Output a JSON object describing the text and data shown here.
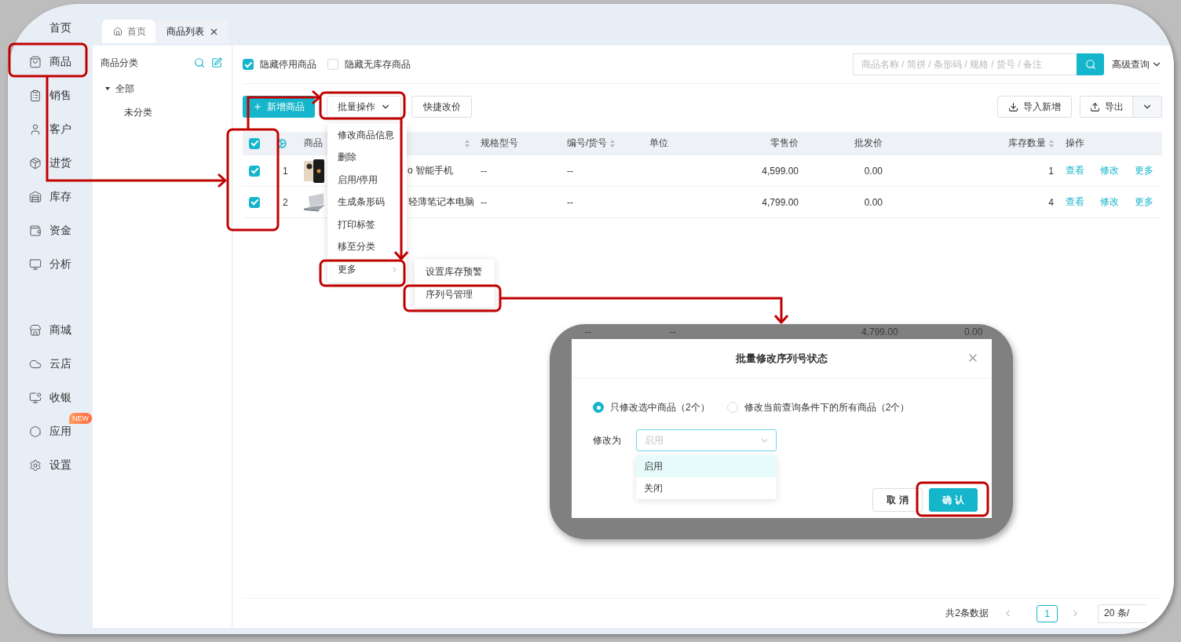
{
  "sidebar": {
    "groups": [
      {
        "items": [
          {
            "label": "首页"
          },
          {
            "label": "商品"
          },
          {
            "label": "销售"
          },
          {
            "label": "客户"
          },
          {
            "label": "进货"
          },
          {
            "label": "库存"
          },
          {
            "label": "资金"
          },
          {
            "label": "分析"
          }
        ]
      },
      {
        "items": [
          {
            "label": "商城"
          },
          {
            "label": "云店"
          },
          {
            "label": "收银"
          },
          {
            "label": "应用",
            "badge": "NEW"
          },
          {
            "label": "设置"
          }
        ]
      }
    ]
  },
  "tabs": [
    {
      "label": "首页",
      "selected": false,
      "closable": false
    },
    {
      "label": "商品列表",
      "selected": true,
      "closable": true
    }
  ],
  "category": {
    "title": "商品分类",
    "tree": [
      {
        "label": "全部",
        "expanded": true,
        "children": [
          {
            "label": "未分类"
          }
        ]
      }
    ]
  },
  "filters": [
    {
      "label": "隐藏停用商品",
      "checked": true
    },
    {
      "label": "隐藏无库存商品",
      "checked": false
    }
  ],
  "search": {
    "placeholder": "商品名称 / 简拼 / 条形码 / 规格 / 货号 / 备注",
    "advanced": "高级查询"
  },
  "toolbar": {
    "left": [
      {
        "label": "新增商品",
        "kind": "primary"
      },
      {
        "label": "批量操作",
        "kind": "dropdown"
      },
      {
        "label": "快捷改价",
        "kind": "plain"
      }
    ],
    "right": [
      {
        "label": "导入新增",
        "kind": "import"
      },
      {
        "label": "导出",
        "kind": "export"
      }
    ]
  },
  "table": {
    "header_checked": true,
    "columns": [
      {
        "label": "商品",
        "sortable": true
      },
      {
        "label": "规格型号",
        "sortable": false
      },
      {
        "label": "编号/货号",
        "sortable": true
      },
      {
        "label": "单位",
        "sortable": false
      },
      {
        "label": "零售价",
        "sortable": false
      },
      {
        "label": "批发价",
        "sortable": false
      },
      {
        "label": "库存数量",
        "sortable": true
      },
      {
        "label": "操作",
        "sortable": false
      }
    ],
    "rows": [
      {
        "checked": true,
        "index": "1",
        "name": "o 智能手机",
        "spec": "--",
        "code": "--",
        "retail": "4,599.00",
        "wholesale": "0.00",
        "stock": "1",
        "actions": [
          "查看",
          "修改",
          "更多"
        ]
      },
      {
        "checked": true,
        "index": "2",
        "name": "轻薄笔记本电脑",
        "spec": "--",
        "code": "--",
        "retail": "4,799.00",
        "wholesale": "0.00",
        "stock": "4",
        "actions": [
          "查看",
          "修改",
          "更多"
        ]
      }
    ]
  },
  "batch_menu": {
    "items": [
      {
        "label": "修改商品信息",
        "kind": "item"
      },
      {
        "label": "删除",
        "kind": "item"
      },
      {
        "label": "启用/停用",
        "kind": "item"
      },
      {
        "label": "生成条形码",
        "kind": "item"
      },
      {
        "label": "打印标签",
        "kind": "item"
      },
      {
        "label": "移至分类",
        "kind": "item"
      },
      {
        "label": "更多",
        "kind": "submenu"
      }
    ]
  },
  "submenu": {
    "items": [
      "设置库存预警",
      "序列号管理"
    ]
  },
  "pagination": {
    "total": "共2条数据",
    "pages": [
      {
        "label": "1",
        "selected": true
      }
    ],
    "page_size": "20 条/"
  },
  "callout": {
    "background_row": [
      "--",
      "--",
      "4,799.00",
      "0.00"
    ],
    "dialog": {
      "title": "批量修改序列号状态",
      "scope_options": [
        {
          "label": "只修改选中商品（2个）",
          "selected": true
        },
        {
          "label": "修改当前查询条件下的所有商品（2个）",
          "selected": false
        }
      ],
      "field_label": "修改为",
      "select": {
        "placeholder": "启用",
        "options": [
          {
            "label": "启用",
            "selected": true
          },
          {
            "label": "关闭",
            "selected": false
          }
        ]
      },
      "buttons": [
        {
          "label": "取 消",
          "kind": "cancel"
        },
        {
          "label": "确 认",
          "kind": "confirm"
        }
      ]
    }
  }
}
